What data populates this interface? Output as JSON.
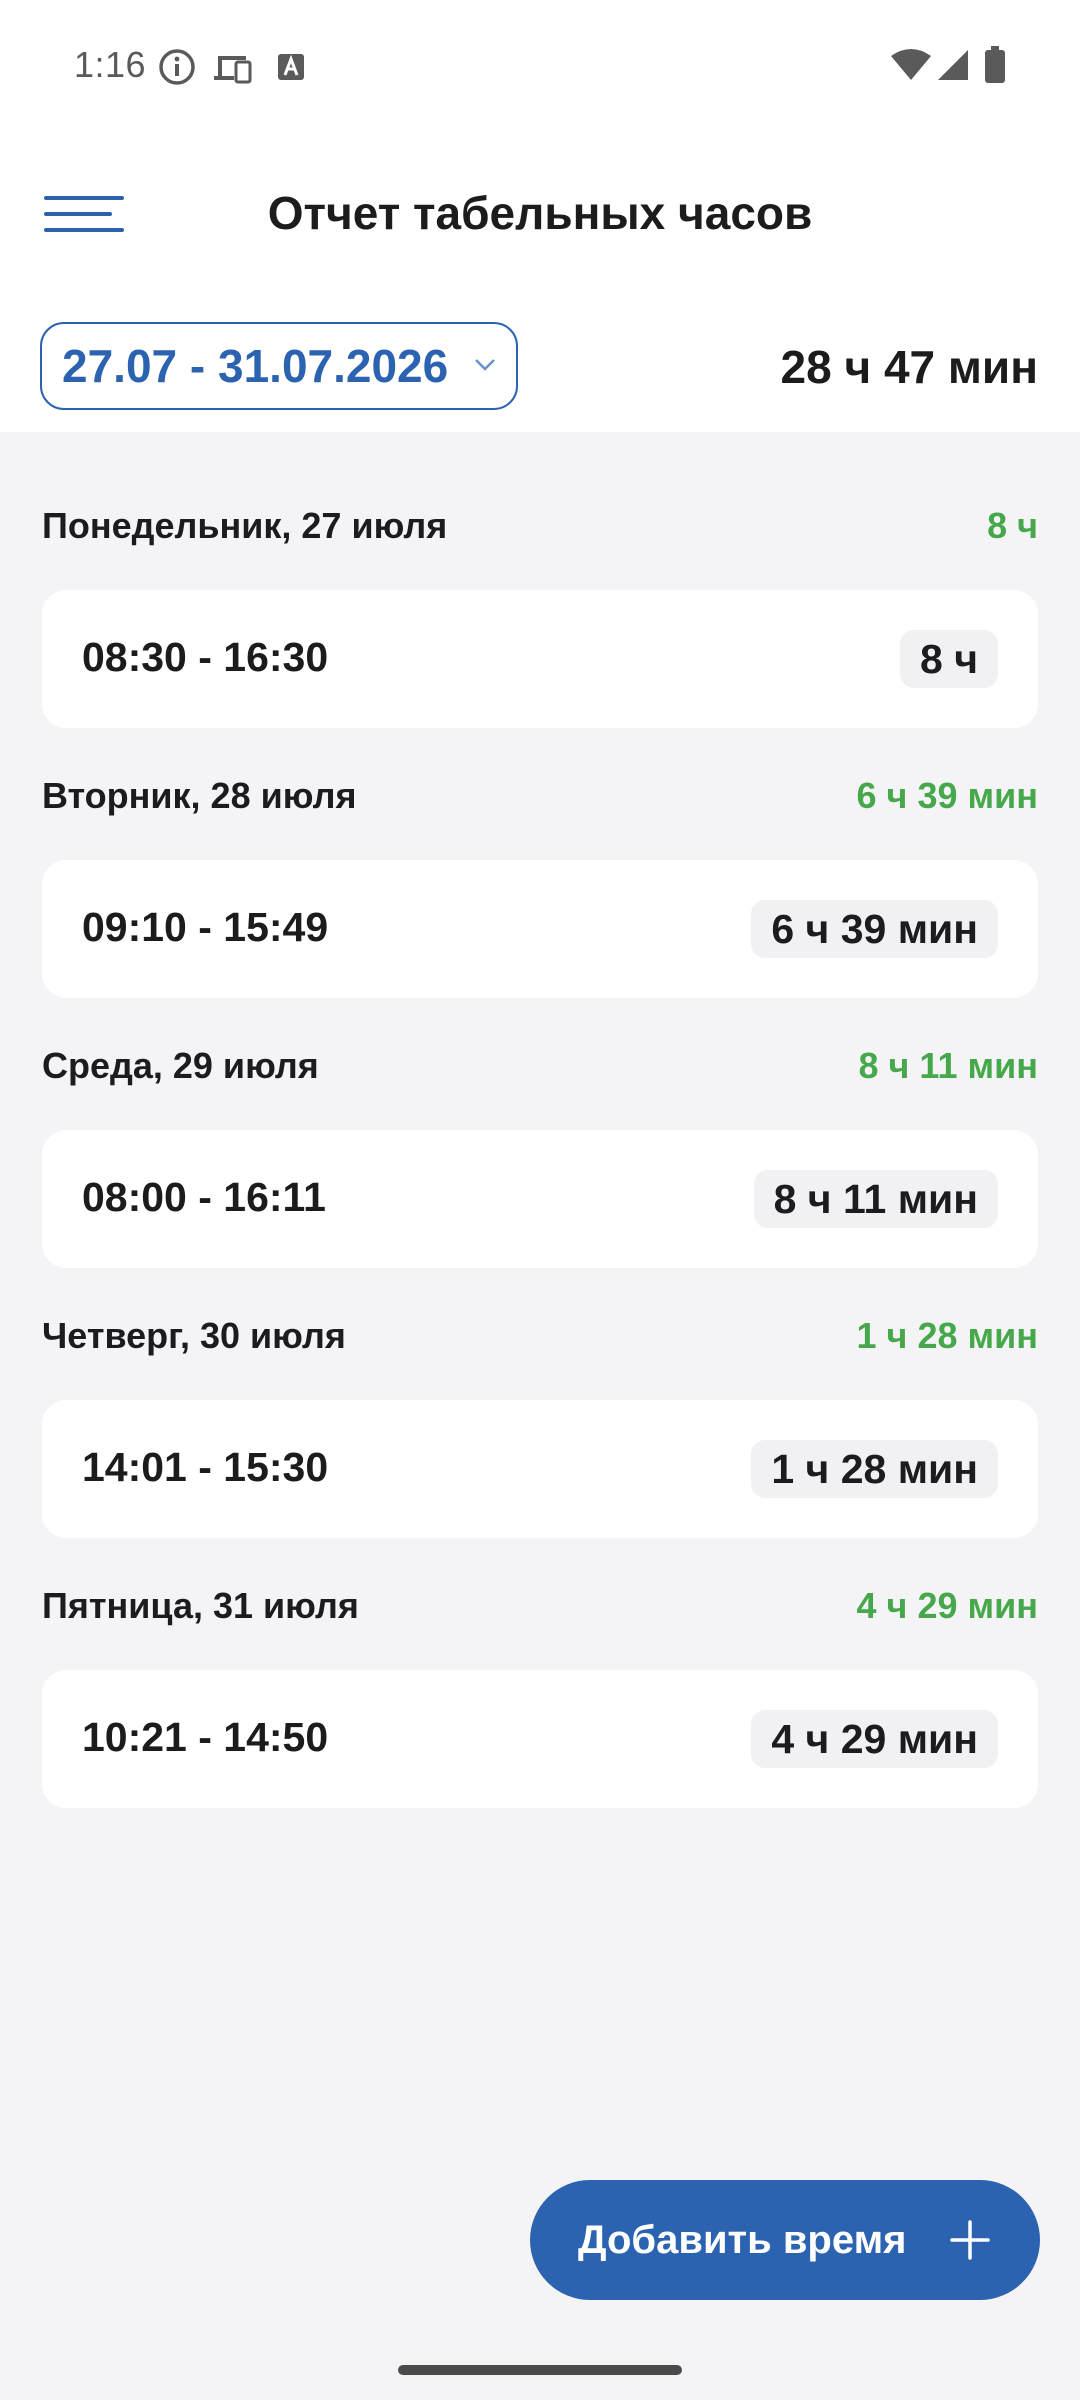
{
  "status_bar": {
    "time": "1:16",
    "icons": [
      "info-icon",
      "devices-icon",
      "font-a-icon",
      "wifi-icon",
      "signal-icon",
      "battery-icon"
    ]
  },
  "header": {
    "title": "Отчет табельных часов",
    "menu_icon": "hamburger-icon"
  },
  "period": {
    "range": "27.07 - 31.07.2026",
    "total": "28 ч 47 мин"
  },
  "days": [
    {
      "name": "Понедельник, 27 июля",
      "total": "8 ч",
      "entries": [
        {
          "time": "08:30 - 16:30",
          "duration": "8 ч"
        }
      ]
    },
    {
      "name": "Вторник, 28 июля",
      "total": "6 ч 39 мин",
      "entries": [
        {
          "time": "09:10 - 15:49",
          "duration": "6 ч 39 мин"
        }
      ]
    },
    {
      "name": "Среда, 29 июля",
      "total": "8 ч 11 мин",
      "entries": [
        {
          "time": "08:00 - 16:11",
          "duration": "8 ч 11 мин"
        }
      ]
    },
    {
      "name": "Четверг, 30 июля",
      "total": "1 ч 28 мин",
      "entries": [
        {
          "time": "14:01 - 15:30",
          "duration": "1 ч 28 мин"
        }
      ]
    },
    {
      "name": "Пятница, 31 июля",
      "total": "4 ч 29 мин",
      "entries": [
        {
          "time": "10:21 - 14:50",
          "duration": "4 ч 29 мин"
        }
      ]
    }
  ],
  "fab": {
    "label": "Добавить время",
    "icon": "plus-icon"
  },
  "colors": {
    "accent": "#2b63b0",
    "day_total": "#46a84b",
    "background": "#f4f4f7",
    "card": "#ffffff"
  }
}
